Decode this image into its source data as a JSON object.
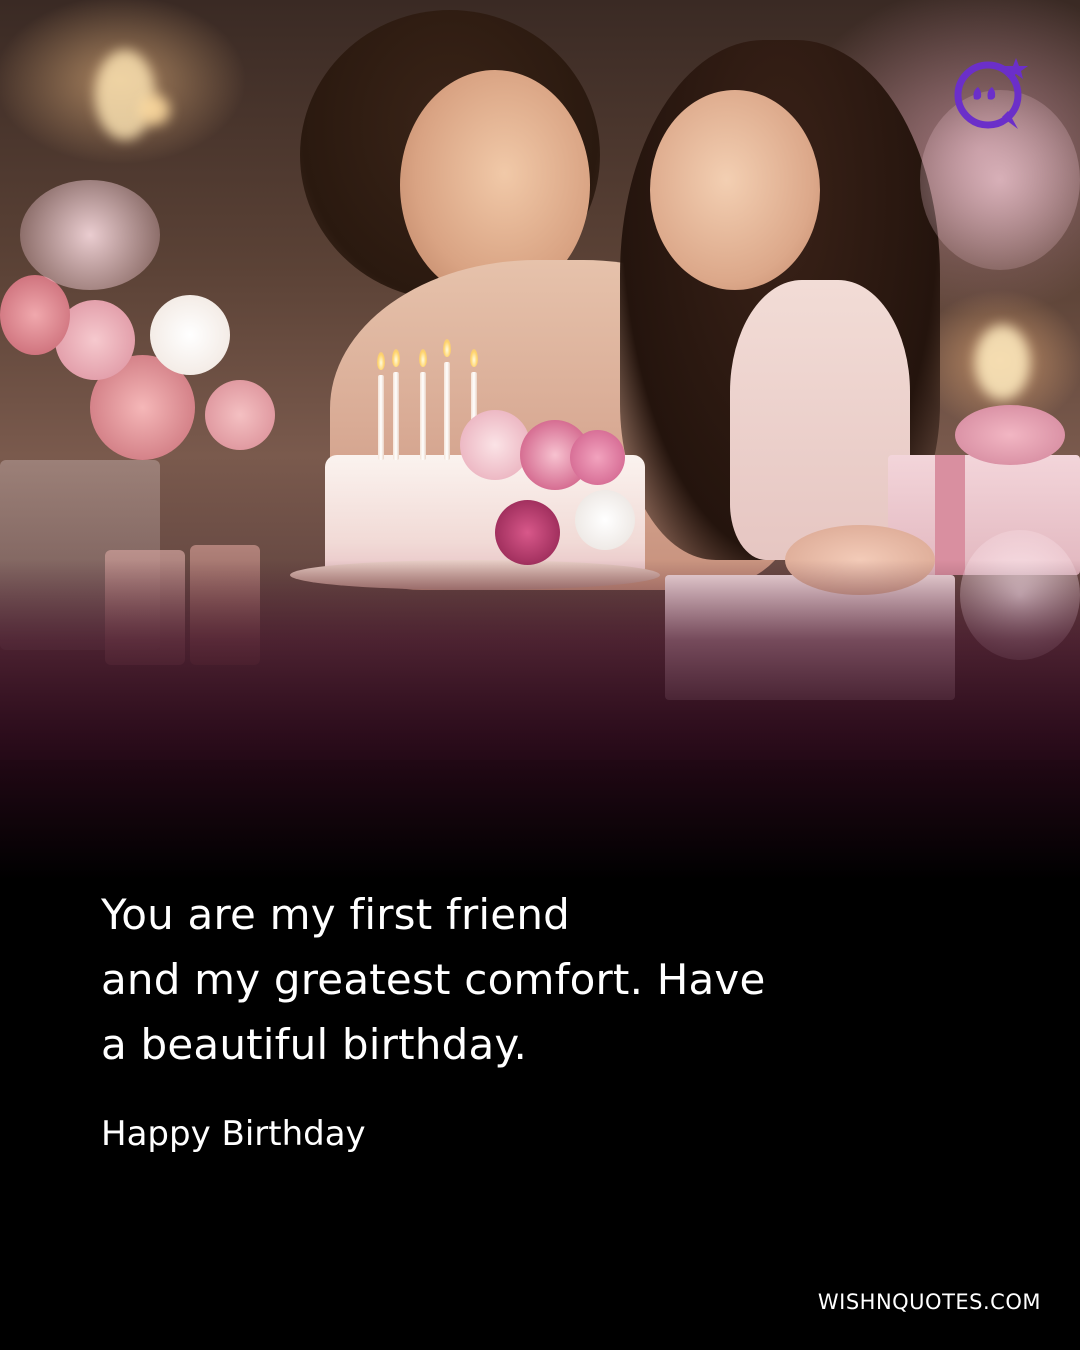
{
  "card": {
    "quote_lines": [
      "You are my first friend",
      "and my greatest comfort. Have",
      "a beautiful birthday."
    ],
    "subtitle": "Happy Birthday",
    "website": "WISHNQUOTES.COM"
  },
  "logo": {
    "icon": "quote-badge-icon",
    "color": "#6b2fc9"
  },
  "photo": {
    "subject": "photo-mother-daughter-birthday"
  },
  "colors": {
    "background": "#000000",
    "text": "#ffffff",
    "accent": "#6b2fc9"
  }
}
